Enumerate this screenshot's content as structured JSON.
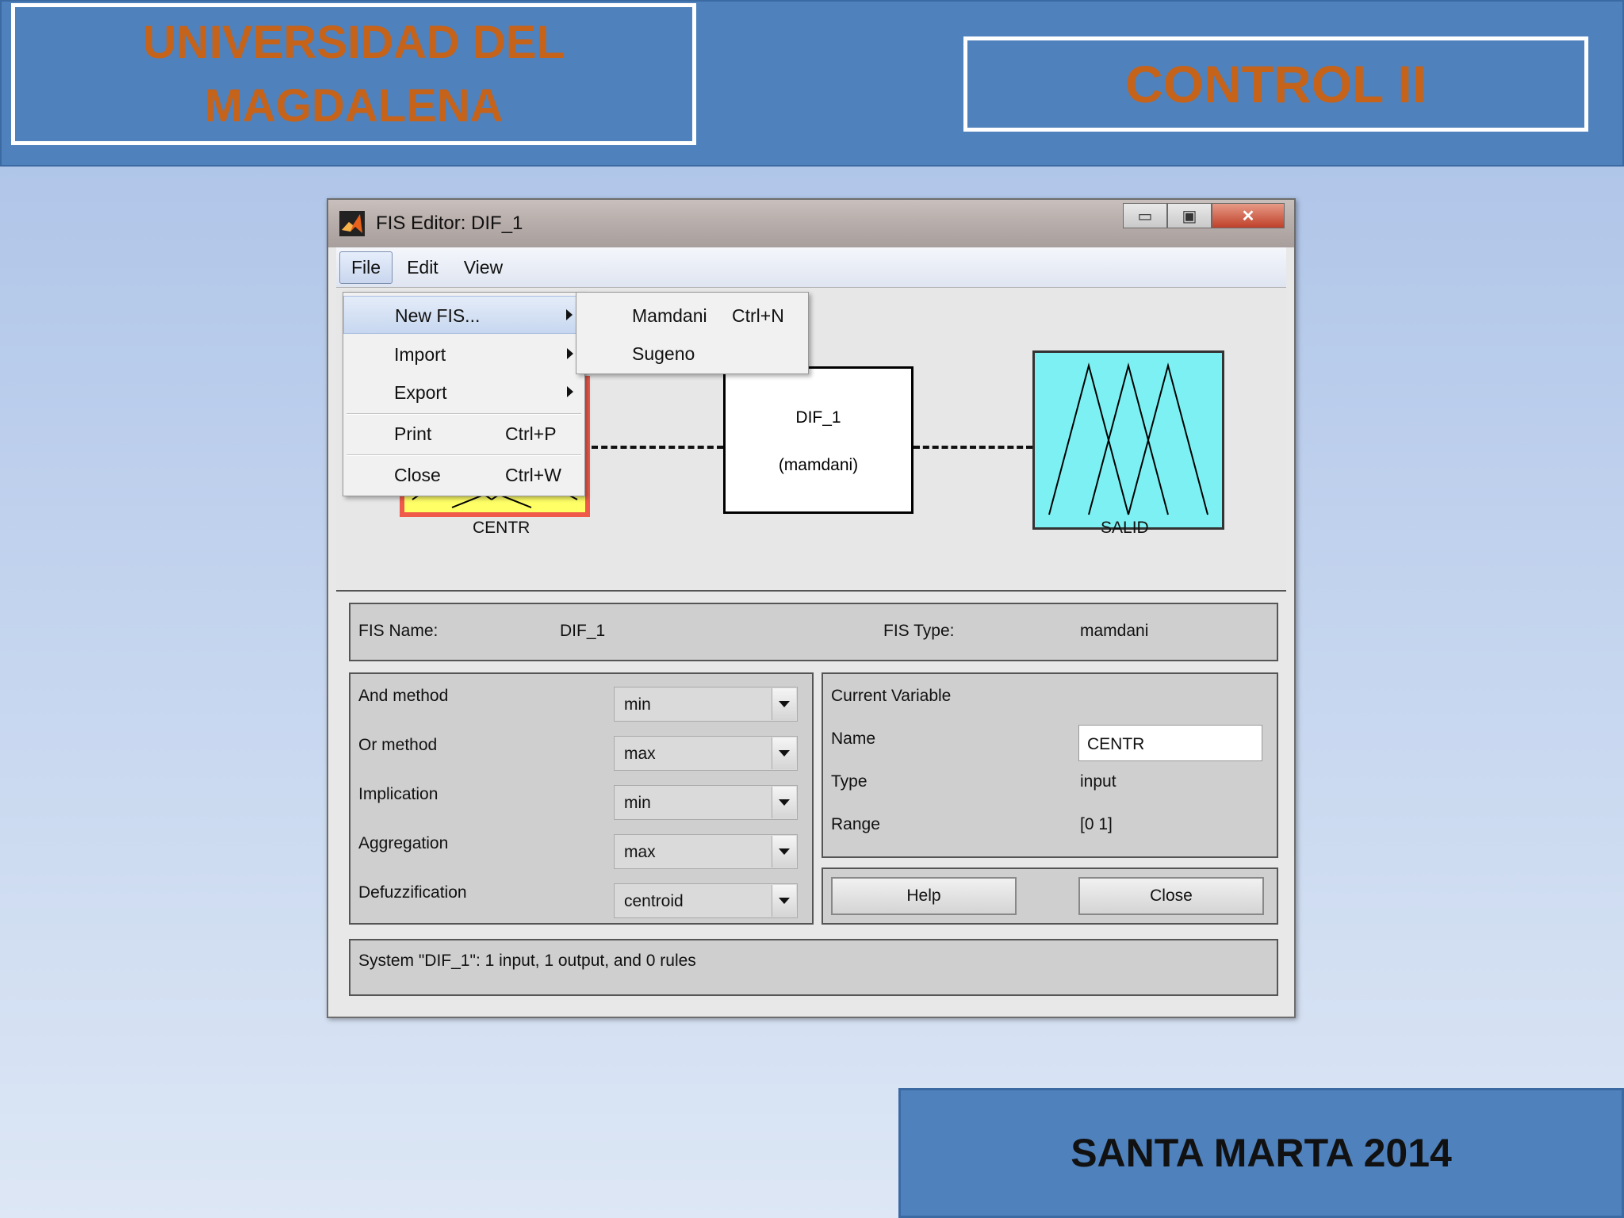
{
  "slide": {
    "university_line1": "UNIVERSIDAD DEL",
    "university_line2": "MAGDALENA",
    "course": "CONTROL II",
    "footer": "SANTA MARTA 2014"
  },
  "window": {
    "title": "FIS Editor: DIF_1",
    "menubar": [
      "File",
      "Edit",
      "View"
    ],
    "controls": {
      "minimize": "▭",
      "maximize": "▣",
      "close": "✕"
    }
  },
  "file_menu": {
    "items": [
      {
        "label": "New FIS...",
        "shortcut": "",
        "submenu": true
      },
      {
        "label": "Import",
        "shortcut": "",
        "submenu": true
      },
      {
        "label": "Export",
        "shortcut": "",
        "submenu": true
      },
      {
        "label": "Print",
        "shortcut": "Ctrl+P",
        "submenu": false
      },
      {
        "label": "Close",
        "shortcut": "Ctrl+W",
        "submenu": false
      }
    ]
  },
  "new_fis_submenu": {
    "items": [
      {
        "label": "Mamdani",
        "shortcut": "Ctrl+N"
      },
      {
        "label": "Sugeno",
        "shortcut": ""
      }
    ]
  },
  "diagram": {
    "input_label": "CENTR",
    "system_name": "DIF_1",
    "system_type": "(mamdani)",
    "output_label": "SALID",
    "colors": {
      "input": "#ffff66",
      "input_border": "#ef5a4a",
      "output": "#7cf0f2"
    }
  },
  "fis_info": {
    "name_label": "FIS Name:",
    "name_value": "DIF_1",
    "type_label": "FIS Type:",
    "type_value": "mamdani"
  },
  "methods": [
    {
      "label": "And method",
      "value": "min"
    },
    {
      "label": "Or method",
      "value": "max"
    },
    {
      "label": "Implication",
      "value": "min"
    },
    {
      "label": "Aggregation",
      "value": "max"
    },
    {
      "label": "Defuzzification",
      "value": "centroid"
    }
  ],
  "current_variable": {
    "heading": "Current Variable",
    "name_label": "Name",
    "name_value": "CENTR",
    "type_label": "Type",
    "type_value": "input",
    "range_label": "Range",
    "range_value": "[0 1]"
  },
  "buttons": {
    "help": "Help",
    "close": "Close"
  },
  "status": "System \"DIF_1\": 1 input, 1 output, and 0 rules"
}
